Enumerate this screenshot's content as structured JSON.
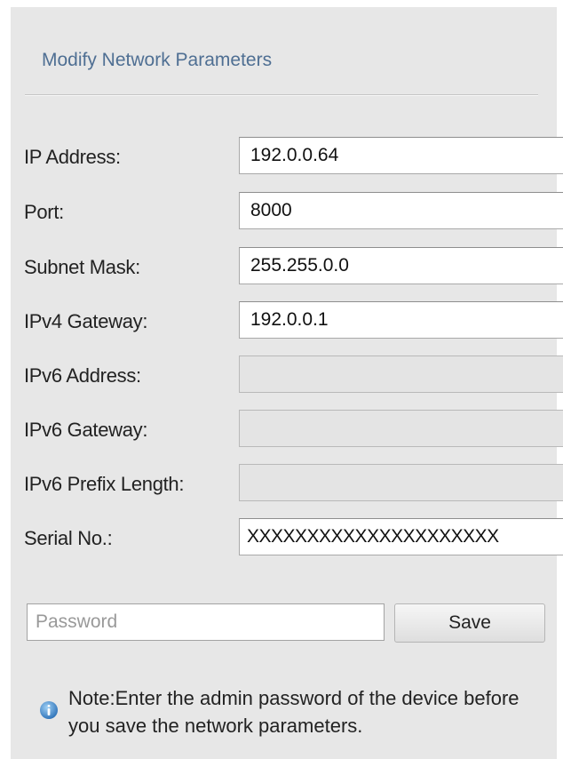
{
  "panel": {
    "title": "Modify Network Parameters"
  },
  "fields": [
    {
      "label": "IP Address:",
      "value": "192.0.0.64",
      "enabled": true
    },
    {
      "label": "Port:",
      "value": "8000",
      "enabled": true
    },
    {
      "label": "Subnet Mask:",
      "value": "255.255.0.0",
      "enabled": true
    },
    {
      "label": "IPv4 Gateway:",
      "value": "192.0.0.1",
      "enabled": true
    },
    {
      "label": "IPv6 Address:",
      "value": "",
      "enabled": false
    },
    {
      "label": "IPv6 Gateway:",
      "value": "",
      "enabled": false
    },
    {
      "label": "IPv6 Prefix Length:",
      "value": "",
      "enabled": false
    },
    {
      "label": "Serial No.:",
      "value": "XXXXXXXXXXXXXXXXXXXXX",
      "enabled": true
    }
  ],
  "password": {
    "placeholder": "Password"
  },
  "actions": {
    "save_label": "Save"
  },
  "note": {
    "icon": "info-icon",
    "text": "Note:Enter the admin password of the device before you save the network parameters."
  },
  "colors": {
    "title": "#4f6f93",
    "panel_background": "#e7e7e7",
    "info_icon": "#3f80c0"
  }
}
